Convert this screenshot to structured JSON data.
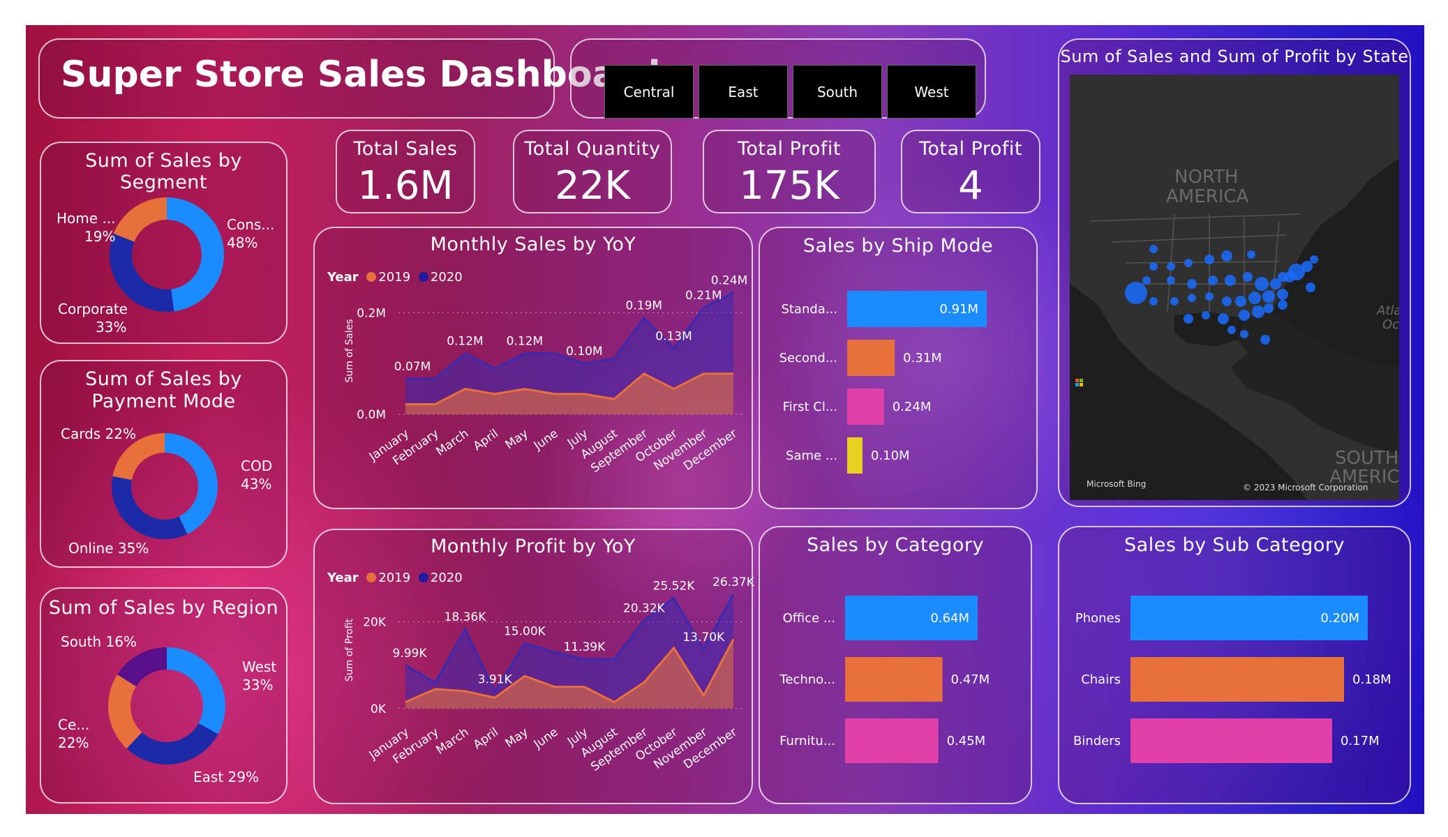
{
  "title": "Super Store Sales Dashboard",
  "regions_slicer": [
    "Central",
    "East",
    "South",
    "West"
  ],
  "kpis": [
    {
      "title": "Total Sales",
      "value": "1.6M"
    },
    {
      "title": "Total Quantity",
      "value": "22K"
    },
    {
      "title": "Total Profit",
      "value": "175K"
    },
    {
      "title": "Total Profit",
      "value": "4"
    }
  ],
  "colors": {
    "blue": "#1a8cff",
    "orange": "#e8703a",
    "navy": "#1c2aa8",
    "magenta": "#e040a8",
    "yellow": "#e8d020",
    "purple": "#5a0f8a",
    "series2019": "#e8703a",
    "series2020": "#1c1c9c"
  },
  "segment_panel": {
    "title": "Sum of Sales by Segment",
    "labels": [
      {
        "name": "Cons...",
        "pct": "48%"
      },
      {
        "name": "Corporate",
        "pct": "33%"
      },
      {
        "name": "Home ...",
        "pct": "19%"
      }
    ]
  },
  "payment_panel": {
    "title": "Sum of Sales by Payment Mode",
    "labels": [
      "COD",
      "43%",
      "Online 35%",
      "Cards 22%"
    ]
  },
  "region_panel": {
    "title": "Sum of Sales by Region",
    "labels": [
      "West",
      "33%",
      "East 29%",
      "Ce...",
      "22%",
      "South 16%"
    ]
  },
  "monthly_sales": {
    "title": "Monthly Sales by YoY",
    "legend_title": "Year",
    "legend": [
      "2019",
      "2020"
    ],
    "ylabel": "Sum of Sales",
    "yticks": [
      "0.2M",
      "0.0M"
    ],
    "data_labels": [
      "0.07M",
      "0.12M",
      "0.12M",
      "0.10M",
      "0.19M",
      "0.13M",
      "0.21M",
      "0.24M"
    ]
  },
  "monthly_profit": {
    "title": "Monthly Profit by YoY",
    "legend_title": "Year",
    "legend": [
      "2019",
      "2020"
    ],
    "ylabel": "Sum of Profit",
    "yticks": [
      "20K",
      "0K"
    ],
    "data_labels": [
      "9.99K",
      "18.36K",
      "3.91K",
      "15.00K",
      "11.39K",
      "20.32K",
      "25.52K",
      "13.70K",
      "26.37K"
    ]
  },
  "months": [
    "January",
    "February",
    "March",
    "April",
    "May",
    "June",
    "July",
    "August",
    "September",
    "October",
    "November",
    "December"
  ],
  "ship_mode": {
    "title": "Sales by Ship Mode",
    "labels": [
      "Standa...",
      "Second...",
      "First Cl...",
      "Same ..."
    ],
    "value_labels": [
      "0.91M",
      "0.31M",
      "0.24M",
      "0.10M"
    ]
  },
  "category": {
    "title": "Sales by Category",
    "labels": [
      "Office ...",
      "Techno...",
      "Furnitu..."
    ],
    "value_labels": [
      "0.64M",
      "0.47M",
      "0.45M"
    ]
  },
  "sub_category": {
    "title": "Sales by Sub Category",
    "labels": [
      "Phones",
      "Chairs",
      "Binders"
    ],
    "value_labels": [
      "0.20M",
      "0.18M",
      "0.17M"
    ]
  },
  "map": {
    "title": "Sum of Sales and Sum of Profit by State",
    "label_north": "NORTH",
    "label_america": "AMERICA",
    "label_south": "SOUTH",
    "label_americ": "AMERIC",
    "label_atl": "Atla",
    "label_oc": "Oc",
    "brand": "Microsoft Bing",
    "copyright": "© 2023 Microsoft Corporation"
  },
  "chart_data": [
    {
      "type": "pie",
      "title": "Sum of Sales by Segment",
      "categories": [
        "Consumer",
        "Corporate",
        "Home Office"
      ],
      "values": [
        48,
        33,
        19
      ]
    },
    {
      "type": "pie",
      "title": "Sum of Sales by Payment Mode",
      "categories": [
        "COD",
        "Online",
        "Cards"
      ],
      "values": [
        43,
        35,
        22
      ]
    },
    {
      "type": "pie",
      "title": "Sum of Sales by Region",
      "categories": [
        "West",
        "East",
        "Central",
        "South"
      ],
      "values": [
        33,
        29,
        22,
        16
      ]
    },
    {
      "type": "area",
      "title": "Monthly Sales by YoY",
      "ylabel": "Sum of Sales",
      "ylim": [
        0,
        0.25
      ],
      "categories": [
        "January",
        "February",
        "March",
        "April",
        "May",
        "June",
        "July",
        "August",
        "September",
        "October",
        "November",
        "December"
      ],
      "series": [
        {
          "name": "2019",
          "values": [
            0.02,
            0.02,
            0.05,
            0.04,
            0.05,
            0.04,
            0.04,
            0.03,
            0.08,
            0.05,
            0.08,
            0.08
          ]
        },
        {
          "name": "2020",
          "values": [
            0.07,
            0.07,
            0.12,
            0.09,
            0.12,
            0.12,
            0.1,
            0.11,
            0.19,
            0.13,
            0.21,
            0.24
          ]
        }
      ]
    },
    {
      "type": "area",
      "title": "Monthly Profit by YoY",
      "ylabel": "Sum of Profit",
      "ylim": [
        -1,
        28
      ],
      "categories": [
        "January",
        "February",
        "March",
        "April",
        "May",
        "June",
        "July",
        "August",
        "September",
        "October",
        "November",
        "December"
      ],
      "series": [
        {
          "name": "2019",
          "values": [
            1.5,
            4.5,
            4,
            2.5,
            7.5,
            5,
            5,
            1.5,
            6,
            14,
            3,
            16
          ]
        },
        {
          "name": "2020",
          "values": [
            9.99,
            6,
            18.36,
            3.91,
            15.0,
            13,
            11.39,
            11.39,
            20.32,
            25.52,
            13.7,
            26.37
          ]
        }
      ]
    },
    {
      "type": "bar",
      "title": "Sales by Ship Mode",
      "categories": [
        "Standard Class",
        "Second Class",
        "First Class",
        "Same Day"
      ],
      "values": [
        0.91,
        0.31,
        0.24,
        0.1
      ]
    },
    {
      "type": "bar",
      "title": "Sales by Category",
      "categories": [
        "Office Supplies",
        "Technology",
        "Furniture"
      ],
      "values": [
        0.64,
        0.47,
        0.45
      ]
    },
    {
      "type": "bar",
      "title": "Sales by Sub Category",
      "categories": [
        "Phones",
        "Chairs",
        "Binders"
      ],
      "values": [
        0.2,
        0.18,
        0.17
      ]
    }
  ]
}
